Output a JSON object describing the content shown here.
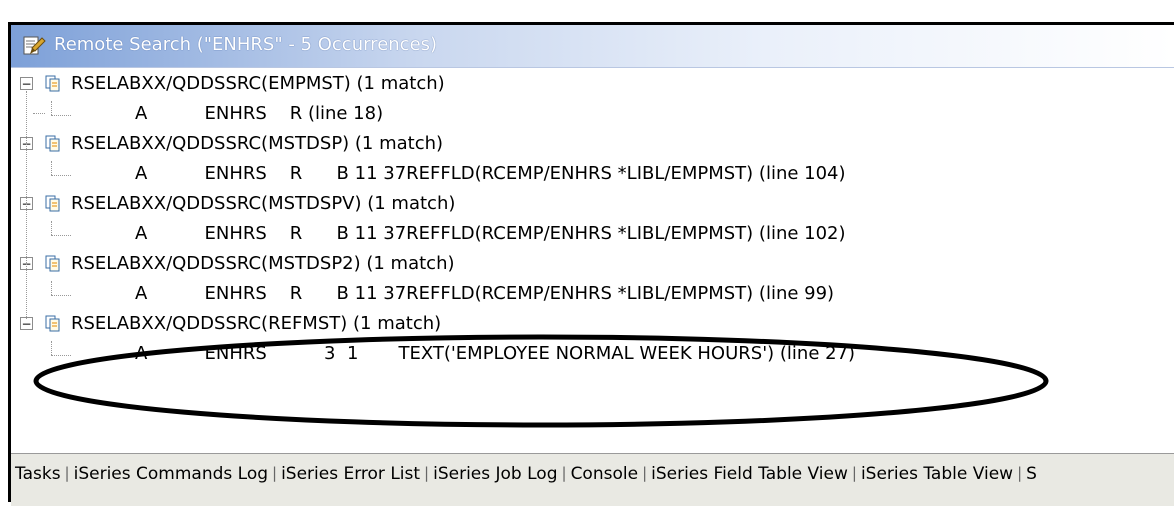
{
  "view": {
    "title": "Remote Search (\"ENHRS\" - 5 Occurrences)",
    "icon": "search-icon"
  },
  "results": [
    {
      "file": "RSELABXX/QDDSSRC(EMPMST) (1 match)",
      "match": "A          ENHRS    R (line 18)"
    },
    {
      "file": "RSELABXX/QDDSSRC(MSTDSP) (1 match)",
      "match": "A          ENHRS    R      B 11 37REFFLD(RCEMP/ENHRS *LIBL/EMPMST) (line 104)"
    },
    {
      "file": "RSELABXX/QDDSSRC(MSTDSPV) (1 match)",
      "match": "A          ENHRS    R      B 11 37REFFLD(RCEMP/ENHRS *LIBL/EMPMST) (line 102)"
    },
    {
      "file": "RSELABXX/QDDSSRC(MSTDSP2) (1 match)",
      "match": "A          ENHRS    R      B 11 37REFFLD(RCEMP/ENHRS *LIBL/EMPMST) (line 99)"
    },
    {
      "file": "RSELABXX/QDDSSRC(REFMST) (1 match)",
      "match": "A          ENHRS          3  1       TEXT('EMPLOYEE NORMAL WEEK HOURS') (line 27)"
    }
  ],
  "tabs": [
    "Tasks",
    "iSeries Commands Log",
    "iSeries Error List",
    "iSeries Job Log",
    "Console",
    "iSeries Field Table View",
    "iSeries Table View",
    "S"
  ],
  "colors": {
    "title_gradient_start": "#7da0d8",
    "tabbar_bg": "#e9e9e3"
  }
}
